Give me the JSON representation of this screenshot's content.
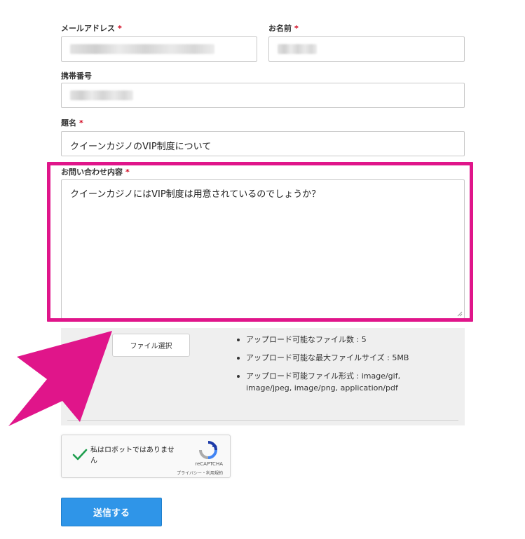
{
  "form": {
    "email": {
      "label": "メールアドレス",
      "required_mark": "*"
    },
    "name": {
      "label": "お名前",
      "required_mark": "*"
    },
    "phone": {
      "label": "携帯番号"
    },
    "subject": {
      "label": "題名",
      "required_mark": "*",
      "value": "クイーンカジノのVIP制度について"
    },
    "message": {
      "label": "お問い合わせ内容",
      "required_mark": "*",
      "value": "クイーンカジノにはVIP制度は用意されているのでしょうか？"
    },
    "upload": {
      "button_label": "ファイル選択",
      "info": [
        "アップロード可能なファイル数 : 5",
        "アップロード可能な最大ファイルサイズ : 5MB",
        "アップロード可能ファイル形式 : image/gif, image/jpeg, image/png, application/pdf"
      ]
    },
    "recaptcha": {
      "checkbox_label": "私はロボットではありません",
      "brand": "reCAPTCHA",
      "links": "プライバシー・利用規約"
    },
    "submit_label": "送信する"
  },
  "colors": {
    "highlight": "#e0158a",
    "arrow": "#e0158a",
    "submit": "#2f95e8",
    "required": "#d0021b"
  }
}
